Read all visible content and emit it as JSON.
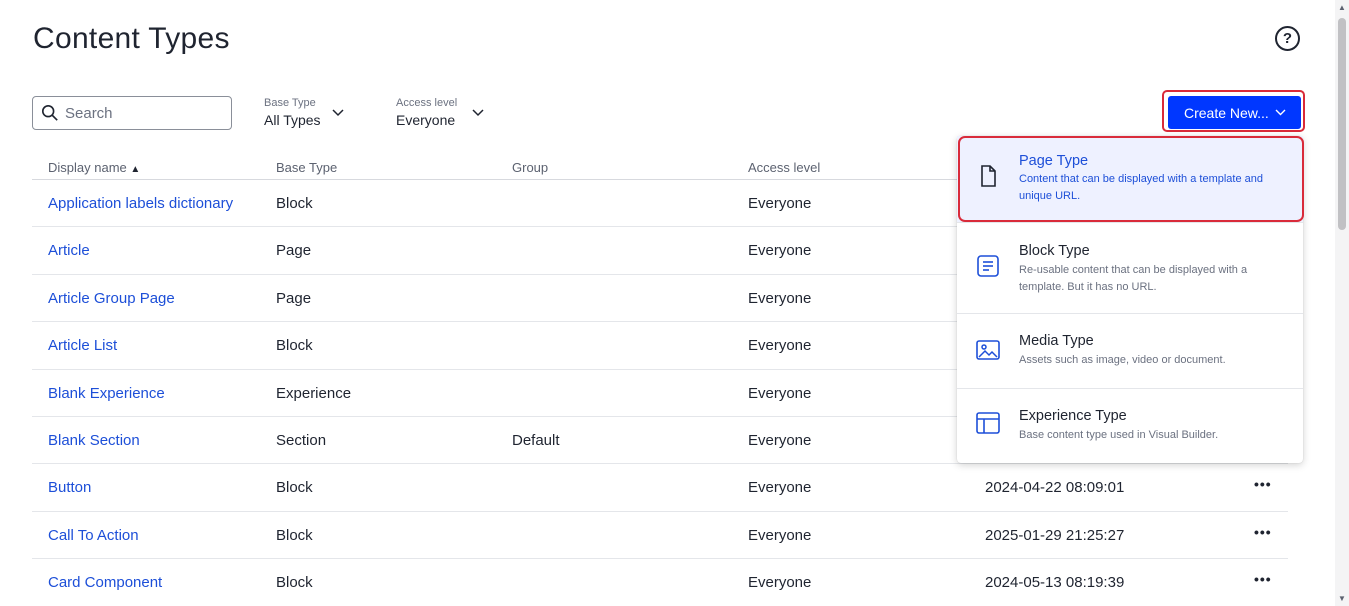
{
  "page": {
    "title": "Content Types"
  },
  "toolbar": {
    "search_placeholder": "Search",
    "base_type": {
      "label": "Base Type",
      "value": "All Types"
    },
    "access_level": {
      "label": "Access level",
      "value": "Everyone"
    },
    "create_label": "Create New..."
  },
  "table": {
    "columns": [
      "Display name",
      "Base Type",
      "Group",
      "Access level"
    ],
    "sort_indicator": "▲",
    "rows": [
      {
        "name": "Application labels dictionary",
        "base": "Block",
        "group": "",
        "access": "Everyone",
        "modified": ""
      },
      {
        "name": "Article",
        "base": "Page",
        "group": "",
        "access": "Everyone",
        "modified": ""
      },
      {
        "name": "Article Group Page",
        "base": "Page",
        "group": "",
        "access": "Everyone",
        "modified": ""
      },
      {
        "name": "Article List",
        "base": "Block",
        "group": "",
        "access": "Everyone",
        "modified": ""
      },
      {
        "name": "Blank Experience",
        "base": "Experience",
        "group": "",
        "access": "Everyone",
        "modified": ""
      },
      {
        "name": "Blank Section",
        "base": "Section",
        "group": "Default",
        "access": "Everyone",
        "modified": ""
      },
      {
        "name": "Button",
        "base": "Block",
        "group": "",
        "access": "Everyone",
        "modified": "2024-04-22 08:09:01"
      },
      {
        "name": "Call To Action",
        "base": "Block",
        "group": "",
        "access": "Everyone",
        "modified": "2025-01-29 21:25:27"
      },
      {
        "name": "Card Component",
        "base": "Block",
        "group": "",
        "access": "Everyone",
        "modified": "2024-05-13 08:19:39"
      }
    ],
    "more_label": "•••"
  },
  "create_menu": {
    "items": [
      {
        "title": "Page Type",
        "desc": "Content that can be displayed with a template and unique URL.",
        "icon": "page-icon"
      },
      {
        "title": "Block Type",
        "desc": "Re-usable content that can be displayed with a template. But it has no URL.",
        "icon": "block-icon"
      },
      {
        "title": "Media Type",
        "desc": "Assets such as image, video or document.",
        "icon": "media-icon"
      },
      {
        "title": "Experience Type",
        "desc": "Base content type used in Visual Builder.",
        "icon": "experience-icon"
      }
    ]
  },
  "colors": {
    "accent": "#0037ff",
    "link": "#1d4fd8",
    "highlight": "#d92b3a"
  }
}
